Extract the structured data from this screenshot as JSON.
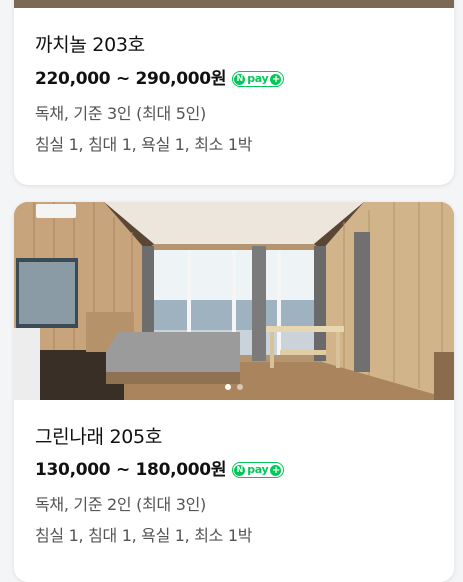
{
  "listings": [
    {
      "name": "까치놀 203호",
      "price": "220,000 ~ 290,000원",
      "pay_badge": "pay",
      "pay_n": "N",
      "pay_plus": "+",
      "capacity": "독채, 기준 3인 (최대 5인)",
      "rooms": "침실 1, 침대 1, 욕실 1, 최소 1박"
    },
    {
      "name": "그린나래 205호",
      "price": "130,000 ~ 180,000원",
      "pay_badge": "pay",
      "pay_n": "N",
      "pay_plus": "+",
      "capacity": "독채, 기준 2인 (최대 3인)",
      "rooms": "침실 1, 침대 1, 욕실 1, 최소 1박",
      "carousel": {
        "total": 2,
        "active": 1
      }
    }
  ],
  "colors": {
    "naverpay_green": "#03c75a",
    "secondary_text": "#555555"
  }
}
